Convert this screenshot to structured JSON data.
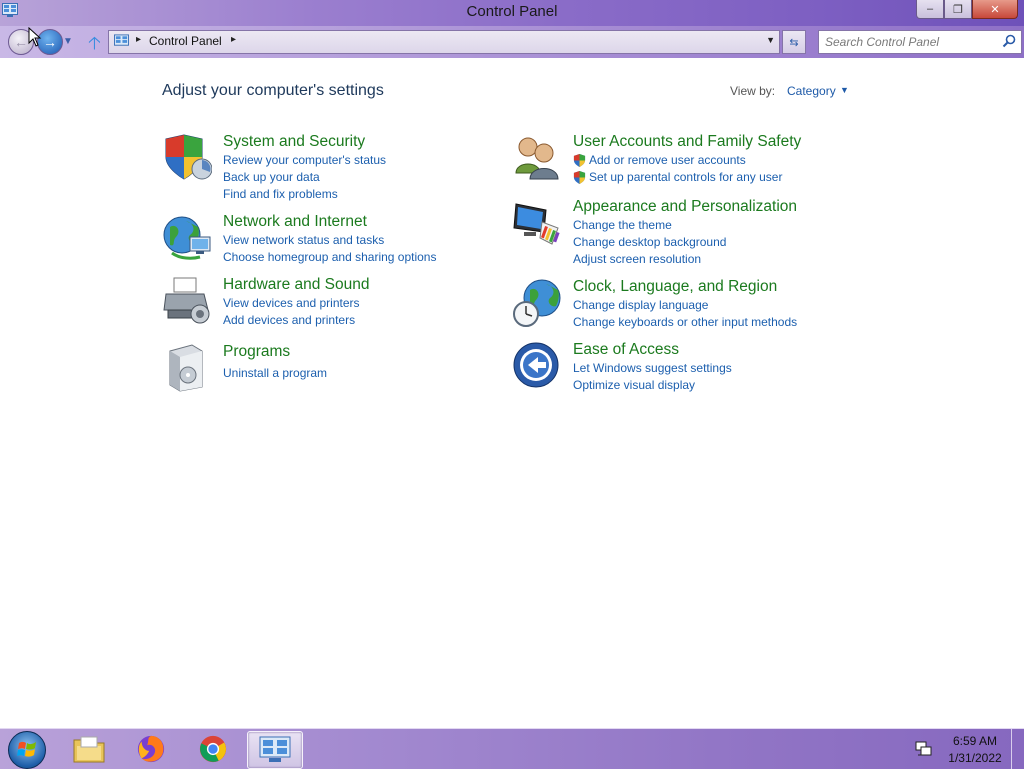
{
  "window": {
    "title": "Control Panel",
    "buttons": {
      "minimize": "–",
      "maximize": "❐",
      "close": "✕"
    }
  },
  "nav": {
    "back_glyph": "←",
    "forward_glyph": "→",
    "recent_glyph": "▼",
    "up_glyph": "🡡",
    "address": {
      "separator": "▸",
      "path_label": "Control Panel",
      "dropdown_glyph": "▼"
    },
    "refresh_glyph": "⇆",
    "search_placeholder": "Search Control Panel"
  },
  "main": {
    "heading": "Adjust your computer's settings",
    "view_by_label": "View by:",
    "view_by_value": "Category",
    "view_by_caret": "▼",
    "categories": [
      {
        "icon": "shield-security-icon",
        "title": "System and Security",
        "links": [
          "Review your computer's status",
          "Back up your data",
          "Find and fix problems"
        ]
      },
      {
        "icon": "network-globe-icon",
        "title": "Network and Internet",
        "links": [
          "View network status and tasks",
          "Choose homegroup and sharing options"
        ]
      },
      {
        "icon": "printer-hardware-icon",
        "title": "Hardware and Sound",
        "links": [
          "View devices and printers",
          "Add devices and printers"
        ]
      },
      {
        "icon": "programs-box-icon",
        "title": "Programs",
        "links": [
          "Uninstall a program"
        ]
      },
      {
        "icon": "users-icon",
        "title": "User Accounts and Family Safety",
        "links": [
          "Add or remove user accounts",
          "Set up parental controls for any user"
        ]
      },
      {
        "icon": "monitor-palette-icon",
        "title": "Appearance and Personalization",
        "links": [
          "Change the theme",
          "Change desktop background",
          "Adjust screen resolution"
        ]
      },
      {
        "icon": "globe-clock-icon",
        "title": "Clock, Language, and Region",
        "links": [
          "Change display language",
          "Change keyboards or other input methods"
        ]
      },
      {
        "icon": "ease-of-access-icon",
        "title": "Ease of Access",
        "links": [
          "Let Windows suggest settings",
          "Optimize visual display"
        ]
      }
    ]
  },
  "taskbar": {
    "items": [
      "start-orb",
      "file-explorer",
      "firefox",
      "chrome",
      "control-panel"
    ],
    "clock": {
      "time": "6:59 AM",
      "date": "1/31/2022"
    }
  },
  "colors": {
    "category_title": "#1b7a1e",
    "link": "#1c5fae",
    "heading": "#1e395b"
  }
}
